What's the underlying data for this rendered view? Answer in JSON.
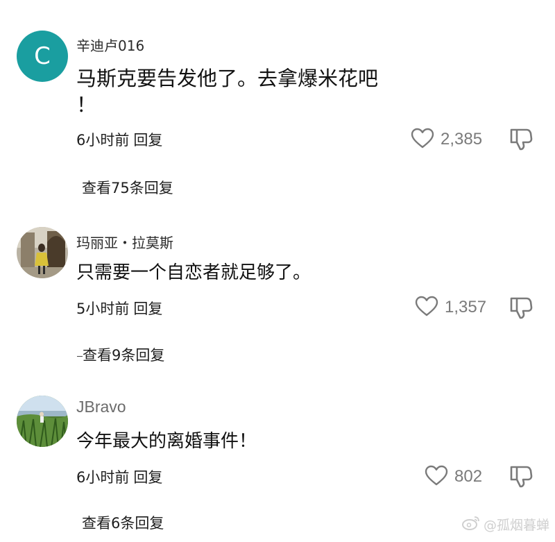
{
  "comments": [
    {
      "avatar_letter": "C",
      "username": "辛迪卢016",
      "text": "马斯克要告发他了。去拿爆米花吧\n！",
      "time": "6小时前",
      "reply_label": "回复",
      "likes": "2,385",
      "view_replies": "查看75条回复"
    },
    {
      "username": "玛丽亚・拉莫斯",
      "text": "只需要一个自恋者就足够了。",
      "time": "5小时前",
      "reply_label": "回复",
      "likes": "1,357",
      "view_replies": "查看9条回复"
    },
    {
      "username": "JBravo",
      "text": "今年最大的离婚事件！",
      "time": "6小时前",
      "reply_label": "回复",
      "likes": "802",
      "view_replies": "查看6条回复"
    }
  ],
  "icons": {
    "like": "heart-outline-icon",
    "dislike": "thumbs-down-outline-icon",
    "watermark": "weibo-icon"
  },
  "watermark": {
    "text": "@孤烟暮蝉"
  },
  "colors": {
    "avatar_c_bg": "#1a9ea0",
    "icon_gray": "#7a7a7a"
  }
}
